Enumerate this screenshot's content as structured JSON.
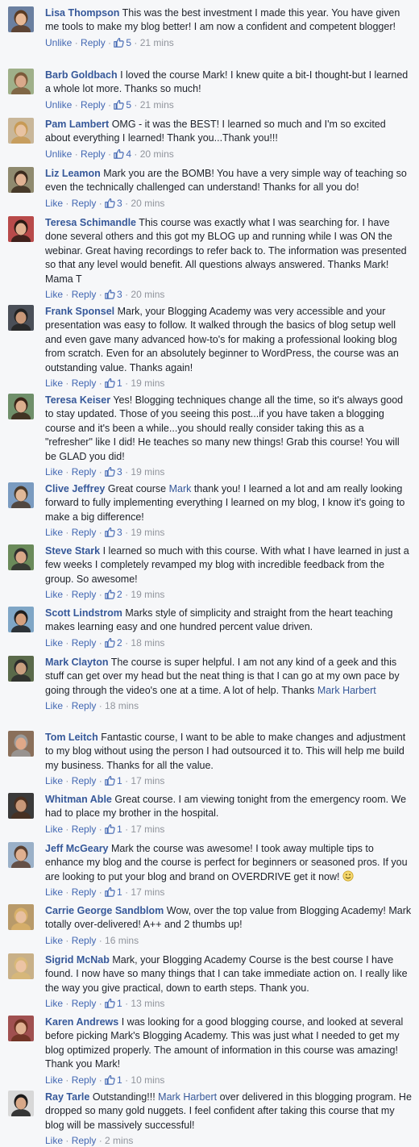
{
  "labels": {
    "like": "Like",
    "unlike": "Unlike",
    "reply": "Reply",
    "dot": "·"
  },
  "colors": {
    "link": "#365899",
    "action": "#4267b2",
    "meta": "#90949c",
    "text": "#1d2129",
    "background": "#f6f7f9"
  },
  "comments": [
    {
      "author": "Lisa Thompson",
      "segments": [
        {
          "t": "This was the best investment I made this year. You have given me tools to make my blog better! I am now a confident and competent blogger!"
        }
      ],
      "action": "Unlike",
      "likes": "5",
      "time": "21 mins",
      "avatar": {
        "bg": "#6a7fa0",
        "skin": "#e7b896",
        "hair": "#5a3a22"
      }
    },
    {
      "author": "Barb Goldbach",
      "segments": [
        {
          "t": "I loved the course Mark! I knew quite a bit-I thought-but I learned a whole lot more. Thanks so much!"
        }
      ],
      "action": "Unlike",
      "likes": "5",
      "time": "21 mins",
      "avatar": {
        "bg": "#9fb08a",
        "skin": "#d9a98b",
        "hair": "#7a5a3a"
      }
    },
    {
      "author": "Pam Lambert",
      "segments": [
        {
          "t": "OMG - it was the BEST! I learned so much and I'm so excited about everything I learned! Thank you...Thank you!!!"
        }
      ],
      "action": "Unlike",
      "likes": "4",
      "time": "20 mins",
      "avatar": {
        "bg": "#c9b79a",
        "skin": "#e8c3a2",
        "hair": "#c79a55"
      }
    },
    {
      "author": "Liz Leamon",
      "segments": [
        {
          "t": "Mark you are the BOMB! You have a very simple way of teaching so even the technically challenged can understand! Thanks for all you do!"
        }
      ],
      "action": "Like",
      "likes": "3",
      "time": "20 mins",
      "avatar": {
        "bg": "#8f8a6f",
        "skin": "#e0b293",
        "hair": "#3b2b1e"
      }
    },
    {
      "author": "Teresa Schimandle",
      "segments": [
        {
          "t": "This course was exactly what I was searching for. I have done several others and this got my BLOG up and running while I was ON the webinar. Great having recordings to refer back to. The information was presented so that any level would benefit. All questions always answered. Thanks Mark! Mama T"
        }
      ],
      "action": "Like",
      "likes": "3",
      "time": "20 mins",
      "avatar": {
        "bg": "#b84a4a",
        "skin": "#e0b090",
        "hair": "#2b1a14"
      }
    },
    {
      "author": "Frank Sponsel",
      "segments": [
        {
          "t": "Mark, your Blogging Academy was very accessible and your presentation was easy to follow. It walked through the basics of blog setup well and even gave many advanced how-to's for making a professional looking blog from scratch. Even for an absolutely beginner to WordPress, the course was an outstanding value. Thanks again!"
        }
      ],
      "action": "Like",
      "likes": "1",
      "time": "19 mins",
      "avatar": {
        "bg": "#4a4f58",
        "skin": "#c99878",
        "hair": "#222222"
      }
    },
    {
      "author": "Teresa Keiser",
      "segments": [
        {
          "t": "Yes! Blogging techniques change all the time, so it's always good to stay updated. Those of you seeing this post...if you have taken a blogging course and it's been a while...you should really consider taking this as a \"refresher\" like I did! He teaches so many new things! Grab this course! You will be GLAD you did!"
        }
      ],
      "action": "Like",
      "likes": "3",
      "time": "19 mins",
      "avatar": {
        "bg": "#6f8f6a",
        "skin": "#dcae8e",
        "hair": "#3a2418"
      }
    },
    {
      "author": "Clive Jeffrey",
      "segments": [
        {
          "t": "Great course "
        },
        {
          "t": "Mark",
          "link": true
        },
        {
          "t": " thank you! I learned a lot and am really looking forward to fully implementing everything I learned on my blog, I know it's going to make a big difference!"
        }
      ],
      "action": "Like",
      "likes": "3",
      "time": "19 mins",
      "avatar": {
        "bg": "#7a9bc0",
        "skin": "#e0b898",
        "hair": "#4a3a2a"
      }
    },
    {
      "author": "Steve Stark",
      "segments": [
        {
          "t": "I learned so much with this course. With what I have learned in just a few weeks I completely revamped my blog with incredible feedback from the group. So awesome!"
        }
      ],
      "action": "Like",
      "likes": "2",
      "time": "19 mins",
      "avatar": {
        "bg": "#6a8a5a",
        "skin": "#d8a888",
        "hair": "#2e2e2e"
      }
    },
    {
      "author": "Scott Lindstrom",
      "segments": [
        {
          "t": "Marks style of simplicity and straight from the heart teaching makes learning easy and one hundred percent value driven."
        }
      ],
      "action": "Like",
      "likes": "2",
      "time": "18 mins",
      "avatar": {
        "bg": "#7fa6c6",
        "skin": "#d4a07e",
        "hair": "#1e1e1e"
      }
    },
    {
      "author": "Mark Clayton",
      "segments": [
        {
          "t": "The course is super helpful. I am not any kind of a geek and this stuff can get over my head but the neat thing is that I can go at my own pace by going through the video's one at a time. A lot of help. Thanks "
        },
        {
          "t": "Mark Harbert",
          "link": true
        }
      ],
      "action": "Like",
      "likes": "",
      "time": "18 mins",
      "avatar": {
        "bg": "#5a6a4a",
        "skin": "#caa080",
        "hair": "#2a2a2a"
      }
    },
    {
      "author": "Tom Leitch",
      "segments": [
        {
          "t": "Fantastic course, I want to be able to make changes and adjustment to my blog without using the person I had outsourced it to. This will help me build my business. Thanks for all the value."
        }
      ],
      "action": "Like",
      "likes": "1",
      "time": "17 mins",
      "avatar": {
        "bg": "#8a6f5a",
        "skin": "#e0a888",
        "hair": "#9a9a9a"
      }
    },
    {
      "author": "Whitman Able",
      "segments": [
        {
          "t": "Great course. I am viewing tonight from the emergency room. We had to place my brother in the hospital."
        }
      ],
      "action": "Like",
      "likes": "1",
      "time": "17 mins",
      "avatar": {
        "bg": "#3a3a3a",
        "skin": "#c89878",
        "hair": "#4a3020"
      }
    },
    {
      "author": "Jeff McGeary",
      "segments": [
        {
          "t": "Mark the course was awesome! I took away multiple tips to enhance my blog and the course is perfect for beginners or seasoned pros. If you are looking to put your blog and brand on OVERDRIVE get it now! "
        },
        {
          "emoji": "smile"
        }
      ],
      "action": "Like",
      "likes": "1",
      "time": "17 mins",
      "avatar": {
        "bg": "#9ab0c8",
        "skin": "#e0b090",
        "hair": "#5a4030"
      }
    },
    {
      "author": "Carrie George Sandblom",
      "segments": [
        {
          "t": "Wow, over the top value from Blogging Academy! Mark totally over-delivered! A++ and 2 thumbs up!"
        }
      ],
      "action": "Like",
      "likes": "",
      "time": "16 mins",
      "avatar": {
        "bg": "#b89a6a",
        "skin": "#e8c0a0",
        "hair": "#d8b068"
      }
    },
    {
      "author": "Sigrid McNab",
      "segments": [
        {
          "t": "Mark, your Blogging Academy Course is the best course I have found. I now have so many things that I can take immediate action on. I really like the way you give practical, down to earth steps. Thank you."
        }
      ],
      "action": "Like",
      "likes": "1",
      "time": "13 mins",
      "avatar": {
        "bg": "#c8b088",
        "skin": "#ecc4a4",
        "hair": "#d8b878"
      }
    },
    {
      "author": "Karen Andrews",
      "segments": [
        {
          "t": "I was looking for a good blogging course, and looked at several before picking Mark's Blogging Academy. This was just what I needed to get my blog optimized properly. The amount of information in this course was amazing! Thank you Mark!"
        }
      ],
      "action": "Like",
      "likes": "1",
      "time": "10 mins",
      "avatar": {
        "bg": "#a05050",
        "skin": "#e0b090",
        "hair": "#6a3020"
      }
    },
    {
      "author": "Ray Tarle",
      "segments": [
        {
          "t": "Outstanding!!! "
        },
        {
          "t": "Mark Harbert",
          "link": true
        },
        {
          "t": " over delivered in this blogging program. He dropped so many gold nuggets. I feel confident after taking this course that my blog will be massively successful!"
        }
      ],
      "action": "Like",
      "likes": "",
      "time": "2 mins",
      "avatar": {
        "bg": "#d8d8d8",
        "skin": "#d8a888",
        "hair": "#1a1a1a"
      }
    }
  ]
}
